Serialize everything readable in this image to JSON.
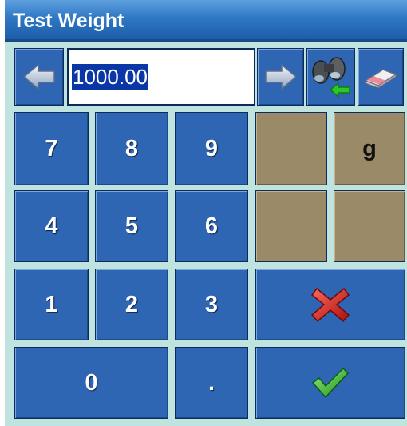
{
  "window": {
    "title": "Test Weight"
  },
  "entry": {
    "value": "1000.00"
  },
  "keypad": {
    "k7": "7",
    "k8": "8",
    "k9": "9",
    "k4": "4",
    "k5": "5",
    "k6": "6",
    "k1": "1",
    "k2": "2",
    "k3": "3",
    "k0": "0",
    "dot": ".",
    "unit": "g"
  },
  "icons": {
    "left": "arrow-left-icon",
    "right": "arrow-right-icon",
    "search": "binoculars-icon",
    "clear": "eraser-icon",
    "cancel": "red-x-icon",
    "ok": "green-check-icon"
  },
  "colors": {
    "title_bar": "#2f78c5",
    "button": "#2f66b4",
    "tan_button": "#9b8a68",
    "background": "#bfe3df",
    "selection": "#0a36a6"
  }
}
